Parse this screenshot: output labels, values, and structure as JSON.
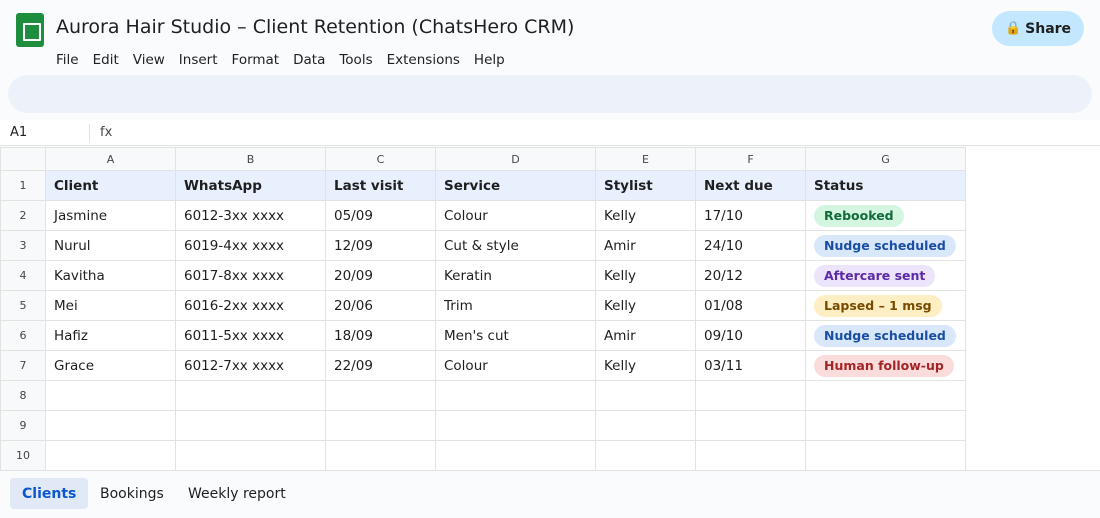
{
  "app": {
    "title": "Aurora Hair Studio – Client Retention (ChatsHero CRM)",
    "share_label": "Share",
    "menu": [
      "File",
      "Edit",
      "View",
      "Insert",
      "Format",
      "Data",
      "Tools",
      "Extensions",
      "Help"
    ]
  },
  "formula_bar": {
    "cell_ref": "A1",
    "fx": "fx"
  },
  "sheet": {
    "columns": [
      "A",
      "B",
      "C",
      "D",
      "E",
      "F",
      "G"
    ],
    "row_numbers": [
      "1",
      "2",
      "3",
      "4",
      "5",
      "6",
      "7",
      "8",
      "9",
      "10"
    ],
    "header": [
      "Client",
      "WhatsApp",
      "Last visit",
      "Service",
      "Stylist",
      "Next due",
      "Status"
    ],
    "rows": [
      [
        "Jasmine",
        "6012-3xx xxxx",
        "05/09",
        "Colour",
        "Kelly",
        "17/10",
        "Rebooked"
      ],
      [
        "Nurul",
        "6019-4xx xxxx",
        "12/09",
        "Cut & style",
        "Amir",
        "24/10",
        "Nudge scheduled"
      ],
      [
        "Kavitha",
        "6017-8xx xxxx",
        "20/09",
        "Keratin",
        "Kelly",
        "20/12",
        "Aftercare sent"
      ],
      [
        "Mei",
        "6016-2xx xxxx",
        "20/06",
        "Trim",
        "Kelly",
        "01/08",
        "Lapsed – 1 msg"
      ],
      [
        "Hafiz",
        "6011-5xx xxxx",
        "18/09",
        "Men's cut",
        "Amir",
        "09/10",
        "Nudge scheduled"
      ],
      [
        "Grace",
        "6012-7xx xxxx",
        "22/09",
        "Colour",
        "Kelly",
        "03/11",
        "Human follow-up"
      ]
    ],
    "status_colors": {
      "Rebooked": {
        "bg": "#d4f5e0",
        "fg": "#116b3a"
      },
      "Nudge scheduled": {
        "bg": "#d9e7fb",
        "fg": "#1a4fa3"
      },
      "Aftercare sent": {
        "bg": "#ece4fb",
        "fg": "#5b2aa8"
      },
      "Lapsed – 1 msg": {
        "bg": "#fdefc3",
        "fg": "#7a4b00"
      },
      "Human follow-up": {
        "bg": "#fbdcdc",
        "fg": "#a32626"
      }
    }
  },
  "tabs": [
    {
      "label": "Clients",
      "active": true
    },
    {
      "label": "Bookings",
      "active": false
    },
    {
      "label": "Weekly report",
      "active": false
    }
  ]
}
